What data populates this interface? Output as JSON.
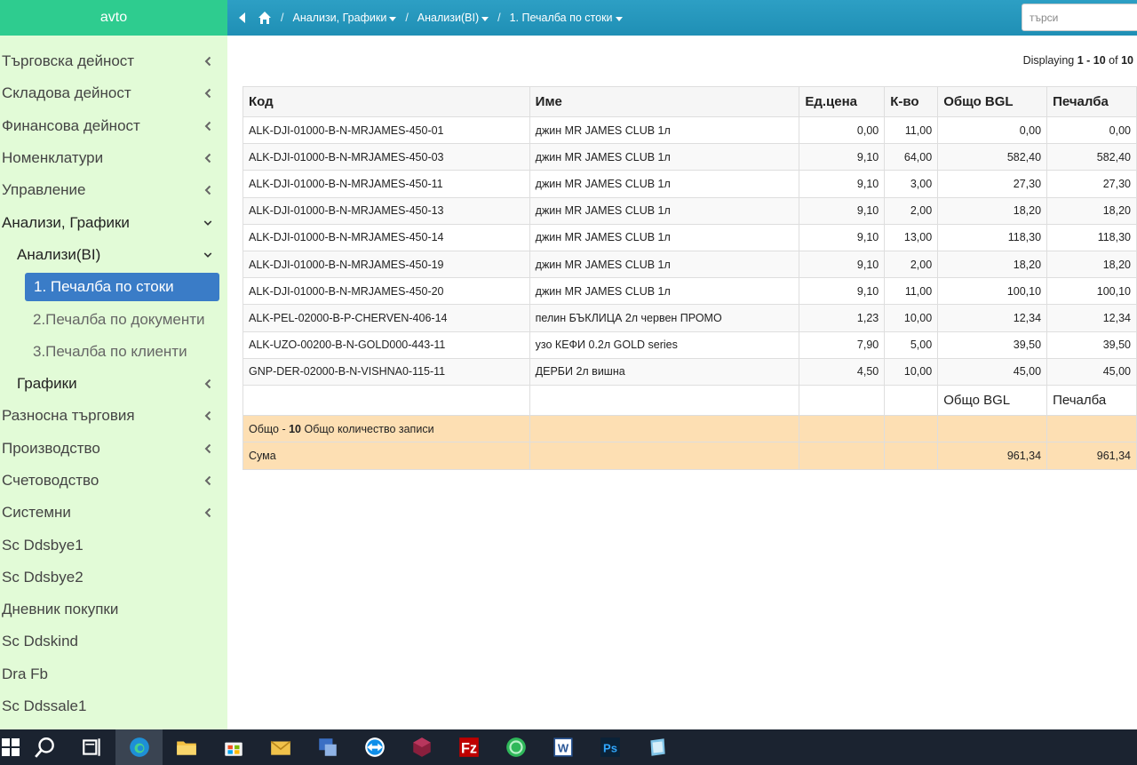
{
  "app": {
    "brand": "avto"
  },
  "sidebar": {
    "items": [
      {
        "label": "Търговска дейност",
        "chevron": "left"
      },
      {
        "label": "Складова дейност",
        "chevron": "left"
      },
      {
        "label": "Финансова дейност",
        "chevron": "left"
      },
      {
        "label": "Номенклатури",
        "chevron": "left"
      },
      {
        "label": "Управление",
        "chevron": "left"
      },
      {
        "label": "Анализи, Графики",
        "chevron": "down"
      },
      {
        "label": "Анализи(BI)",
        "chevron": "down"
      },
      {
        "label": "1. Печалба по стоки",
        "active": true
      },
      {
        "label": "2.Печалба по документи"
      },
      {
        "label": "3.Печалба по клиенти"
      },
      {
        "label": "Графики",
        "chevron": "left"
      },
      {
        "label": "Разносна търговия",
        "chevron": "left"
      },
      {
        "label": "Производство",
        "chevron": "left"
      },
      {
        "label": "Счетоводство",
        "chevron": "left"
      },
      {
        "label": "Системни",
        "chevron": "left"
      },
      {
        "label": "Sc Ddsbye1"
      },
      {
        "label": "Sc Ddsbye2"
      },
      {
        "label": "Дневник покупки"
      },
      {
        "label": "Sc Ddskind"
      },
      {
        "label": "Dra Fb"
      },
      {
        "label": "Sc Ddssale1"
      }
    ]
  },
  "topbar": {
    "breadcrumb": [
      "Анализи, Графики",
      "Анализи(BI)",
      "1. Печалба по стоки"
    ],
    "search_placeholder": "търси"
  },
  "pager": {
    "prefix": "Displaying",
    "range": "1 - 10",
    "of": "of",
    "total": "10"
  },
  "table": {
    "columns": [
      "Код",
      "Име",
      "Ед.цена",
      "К-во",
      "Общо BGL",
      "Печалба"
    ],
    "rows": [
      [
        "ALK-DJI-01000-B-N-MRJAMES-450-01",
        "джин MR JAMES CLUB 1л",
        "0,00",
        "11,00",
        "0,00",
        "0,00"
      ],
      [
        "ALK-DJI-01000-B-N-MRJAMES-450-03",
        "джин MR JAMES CLUB 1л",
        "9,10",
        "64,00",
        "582,40",
        "582,40"
      ],
      [
        "ALK-DJI-01000-B-N-MRJAMES-450-11",
        "джин MR JAMES CLUB 1л",
        "9,10",
        "3,00",
        "27,30",
        "27,30"
      ],
      [
        "ALK-DJI-01000-B-N-MRJAMES-450-13",
        "джин MR JAMES CLUB 1л",
        "9,10",
        "2,00",
        "18,20",
        "18,20"
      ],
      [
        "ALK-DJI-01000-B-N-MRJAMES-450-14",
        "джин MR JAMES CLUB 1л",
        "9,10",
        "13,00",
        "118,30",
        "118,30"
      ],
      [
        "ALK-DJI-01000-B-N-MRJAMES-450-19",
        "джин MR JAMES CLUB 1л",
        "9,10",
        "2,00",
        "18,20",
        "18,20"
      ],
      [
        "ALK-DJI-01000-B-N-MRJAMES-450-20",
        "джин MR JAMES CLUB 1л",
        "9,10",
        "11,00",
        "100,10",
        "100,10"
      ],
      [
        "ALK-PEL-02000-B-P-CHERVEN-406-14",
        "пелин БЪКЛИЦА 2л червен ПРОМО",
        "1,23",
        "10,00",
        "12,34",
        "12,34"
      ],
      [
        "ALK-UZO-00200-B-N-GOLD000-443-11",
        "узо КЕФИ 0.2л GOLD series",
        "7,90",
        "5,00",
        "39,50",
        "39,50"
      ],
      [
        "GNP-DER-02000-B-N-VISHNA0-115-11",
        "ДЕРБИ 2л вишна",
        "4,50",
        "10,00",
        "45,00",
        "45,00"
      ]
    ],
    "footer_labels": {
      "total_bgl": "Общо BGL",
      "profit": "Печалба"
    },
    "summary_count": {
      "prefix": "Общо -",
      "count": "10",
      "suffix": "Общо количество записи"
    },
    "summary_sum": {
      "label": "Сума",
      "total_bgl": "961,34",
      "profit": "961,34"
    }
  },
  "taskbar": {
    "icons": [
      "windows-start-icon",
      "search-icon",
      "task-view-icon",
      "edge-browser-icon",
      "file-explorer-icon",
      "store-icon",
      "mail-icon",
      "network-app-icon",
      "teamviewer-icon",
      "winrar-icon",
      "filezilla-icon",
      "green-circle-app-icon",
      "word-icon",
      "photoshop-icon",
      "notepad-icon"
    ]
  }
}
